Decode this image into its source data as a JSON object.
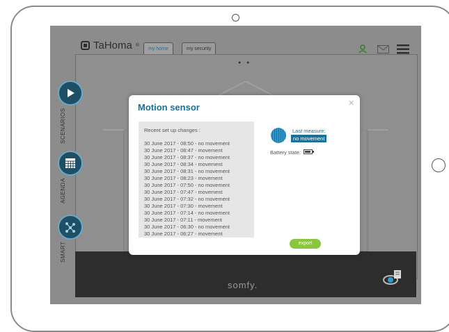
{
  "header": {
    "brand": "TaHoma",
    "brand_mark": "®",
    "tabs": [
      {
        "label": "my home",
        "active": true
      },
      {
        "label": "my security",
        "active": false
      }
    ],
    "icons": [
      "user-at-icon",
      "mail-icon",
      "menu-icon"
    ]
  },
  "sidebar": {
    "items": [
      {
        "label": "SCENARIOS",
        "icon": "play-icon"
      },
      {
        "label": "AGENDA",
        "icon": "calendar-grid-icon"
      },
      {
        "label": "SMART",
        "icon": "network-icon"
      }
    ]
  },
  "footer": {
    "brand": "somfy."
  },
  "modal": {
    "title": "Motion sensor",
    "close_glyph": "×",
    "changes_title": "Recent set up changes :",
    "changes": [
      "30 June 2017 - 08:50 - no movement",
      "30 June 2017 - 08:47 - movement",
      "30 June 2017 - 08:37 - no movement",
      "30 June 2017 - 08:34 - movement",
      "30 June 2017 - 08:31 - no movement",
      "30 June 2017 - 08:23 - movement",
      "30 June 2017 - 07:50 - no movement",
      "30 June 2017 - 07:47 - movement",
      "30 June 2017 - 07:32 - no movement",
      "30 June 2017 - 07:30 - movement",
      "30 June 2017 - 07:14 - no movement",
      "30 June 2017 - 07:11 - movement",
      "30 June 2017 - 06:30 - no movement",
      "30 June 2017 - 06:27 - movement"
    ],
    "last_measure_label": "Last measure:",
    "last_measure_value": "no movement",
    "battery_label": "Battery state:",
    "export_label": "export"
  },
  "colors": {
    "accent": "#1d6f98",
    "export_button": "#8cc63f",
    "screen_dim": "#8c8c8c"
  }
}
